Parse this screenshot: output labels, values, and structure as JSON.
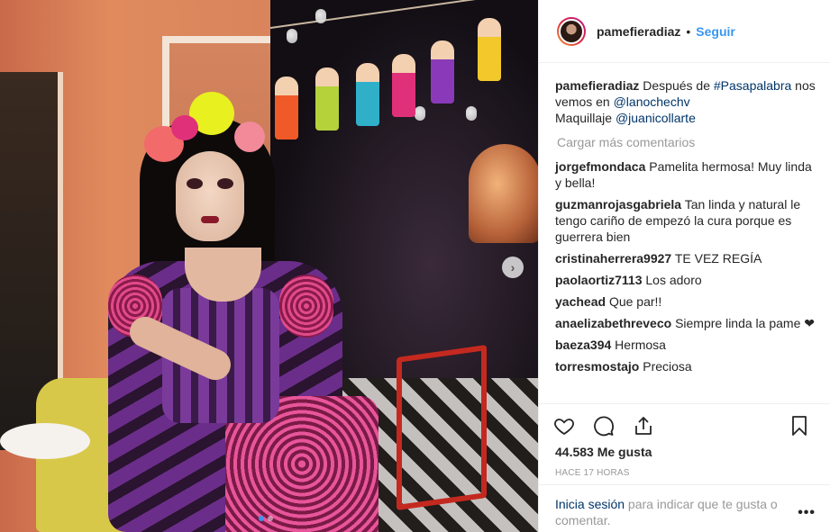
{
  "post": {
    "username": "pamefieradiaz",
    "separator": "•",
    "follow_label": "Seguir",
    "caption": {
      "username": "pamefieradiaz",
      "text_1": "Después de ",
      "tag_1": "#Pasapalabra",
      "text_2": "nos vemos en ",
      "tag_2": "@lanochechv",
      "text_3": "Maquillaje ",
      "tag_3": "@juanicollarte"
    },
    "load_more": "Cargar más comentarios",
    "comments": [
      {
        "user": "jorgefmondaca",
        "text": "Pamelita hermosa! Muy linda y bella!"
      },
      {
        "user": "guzmanrojasgabriela",
        "text": "Tan linda y natural le tengo cariño de empezó la cura porque es guerrera bien"
      },
      {
        "user": "cristinaherrera9927",
        "text": "TE VEZ REGÍA"
      },
      {
        "user": "paolaortiz7113",
        "text": "Los adoro"
      },
      {
        "user": "yachead",
        "text": "Que par!!"
      },
      {
        "user": "anaelizabethreveco",
        "text": "Siempre linda la pame ❤"
      },
      {
        "user": "baeza394",
        "text": "Hermosa"
      },
      {
        "user": "torresmostajo",
        "text": "Preciosa"
      }
    ],
    "likes": "44.583 Me gusta",
    "time": "HACE 17 HORAS",
    "login": {
      "link": "Inicia sesión",
      "text": " para indicar que te gusta o comentar."
    },
    "more_label": "•••",
    "next_label": "›",
    "icons": {
      "like": "heart-icon",
      "comment": "comment-bubble-icon",
      "share": "share-icon",
      "save": "bookmark-icon"
    },
    "colors": {
      "link": "#003569",
      "follow": "#3897f0",
      "muted": "#999999"
    }
  }
}
